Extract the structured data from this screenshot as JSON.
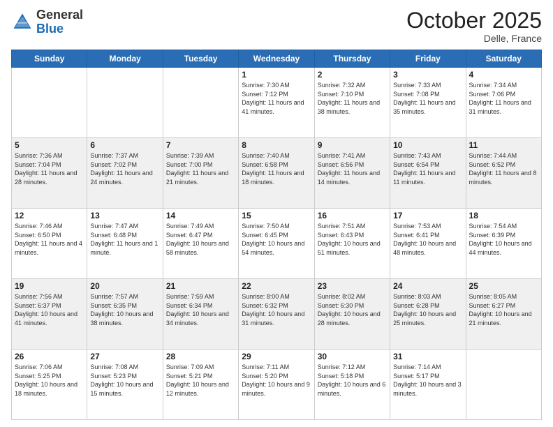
{
  "header": {
    "logo_general": "General",
    "logo_blue": "Blue",
    "month": "October 2025",
    "location": "Delle, France"
  },
  "weekdays": [
    "Sunday",
    "Monday",
    "Tuesday",
    "Wednesday",
    "Thursday",
    "Friday",
    "Saturday"
  ],
  "weeks": [
    [
      {
        "day": "",
        "sunrise": "",
        "sunset": "",
        "daylight": ""
      },
      {
        "day": "",
        "sunrise": "",
        "sunset": "",
        "daylight": ""
      },
      {
        "day": "",
        "sunrise": "",
        "sunset": "",
        "daylight": ""
      },
      {
        "day": "1",
        "sunrise": "Sunrise: 7:30 AM",
        "sunset": "Sunset: 7:12 PM",
        "daylight": "Daylight: 11 hours and 41 minutes."
      },
      {
        "day": "2",
        "sunrise": "Sunrise: 7:32 AM",
        "sunset": "Sunset: 7:10 PM",
        "daylight": "Daylight: 11 hours and 38 minutes."
      },
      {
        "day": "3",
        "sunrise": "Sunrise: 7:33 AM",
        "sunset": "Sunset: 7:08 PM",
        "daylight": "Daylight: 11 hours and 35 minutes."
      },
      {
        "day": "4",
        "sunrise": "Sunrise: 7:34 AM",
        "sunset": "Sunset: 7:06 PM",
        "daylight": "Daylight: 11 hours and 31 minutes."
      }
    ],
    [
      {
        "day": "5",
        "sunrise": "Sunrise: 7:36 AM",
        "sunset": "Sunset: 7:04 PM",
        "daylight": "Daylight: 11 hours and 28 minutes."
      },
      {
        "day": "6",
        "sunrise": "Sunrise: 7:37 AM",
        "sunset": "Sunset: 7:02 PM",
        "daylight": "Daylight: 11 hours and 24 minutes."
      },
      {
        "day": "7",
        "sunrise": "Sunrise: 7:39 AM",
        "sunset": "Sunset: 7:00 PM",
        "daylight": "Daylight: 11 hours and 21 minutes."
      },
      {
        "day": "8",
        "sunrise": "Sunrise: 7:40 AM",
        "sunset": "Sunset: 6:58 PM",
        "daylight": "Daylight: 11 hours and 18 minutes."
      },
      {
        "day": "9",
        "sunrise": "Sunrise: 7:41 AM",
        "sunset": "Sunset: 6:56 PM",
        "daylight": "Daylight: 11 hours and 14 minutes."
      },
      {
        "day": "10",
        "sunrise": "Sunrise: 7:43 AM",
        "sunset": "Sunset: 6:54 PM",
        "daylight": "Daylight: 11 hours and 11 minutes."
      },
      {
        "day": "11",
        "sunrise": "Sunrise: 7:44 AM",
        "sunset": "Sunset: 6:52 PM",
        "daylight": "Daylight: 11 hours and 8 minutes."
      }
    ],
    [
      {
        "day": "12",
        "sunrise": "Sunrise: 7:46 AM",
        "sunset": "Sunset: 6:50 PM",
        "daylight": "Daylight: 11 hours and 4 minutes."
      },
      {
        "day": "13",
        "sunrise": "Sunrise: 7:47 AM",
        "sunset": "Sunset: 6:48 PM",
        "daylight": "Daylight: 11 hours and 1 minute."
      },
      {
        "day": "14",
        "sunrise": "Sunrise: 7:49 AM",
        "sunset": "Sunset: 6:47 PM",
        "daylight": "Daylight: 10 hours and 58 minutes."
      },
      {
        "day": "15",
        "sunrise": "Sunrise: 7:50 AM",
        "sunset": "Sunset: 6:45 PM",
        "daylight": "Daylight: 10 hours and 54 minutes."
      },
      {
        "day": "16",
        "sunrise": "Sunrise: 7:51 AM",
        "sunset": "Sunset: 6:43 PM",
        "daylight": "Daylight: 10 hours and 51 minutes."
      },
      {
        "day": "17",
        "sunrise": "Sunrise: 7:53 AM",
        "sunset": "Sunset: 6:41 PM",
        "daylight": "Daylight: 10 hours and 48 minutes."
      },
      {
        "day": "18",
        "sunrise": "Sunrise: 7:54 AM",
        "sunset": "Sunset: 6:39 PM",
        "daylight": "Daylight: 10 hours and 44 minutes."
      }
    ],
    [
      {
        "day": "19",
        "sunrise": "Sunrise: 7:56 AM",
        "sunset": "Sunset: 6:37 PM",
        "daylight": "Daylight: 10 hours and 41 minutes."
      },
      {
        "day": "20",
        "sunrise": "Sunrise: 7:57 AM",
        "sunset": "Sunset: 6:35 PM",
        "daylight": "Daylight: 10 hours and 38 minutes."
      },
      {
        "day": "21",
        "sunrise": "Sunrise: 7:59 AM",
        "sunset": "Sunset: 6:34 PM",
        "daylight": "Daylight: 10 hours and 34 minutes."
      },
      {
        "day": "22",
        "sunrise": "Sunrise: 8:00 AM",
        "sunset": "Sunset: 6:32 PM",
        "daylight": "Daylight: 10 hours and 31 minutes."
      },
      {
        "day": "23",
        "sunrise": "Sunrise: 8:02 AM",
        "sunset": "Sunset: 6:30 PM",
        "daylight": "Daylight: 10 hours and 28 minutes."
      },
      {
        "day": "24",
        "sunrise": "Sunrise: 8:03 AM",
        "sunset": "Sunset: 6:28 PM",
        "daylight": "Daylight: 10 hours and 25 minutes."
      },
      {
        "day": "25",
        "sunrise": "Sunrise: 8:05 AM",
        "sunset": "Sunset: 6:27 PM",
        "daylight": "Daylight: 10 hours and 21 minutes."
      }
    ],
    [
      {
        "day": "26",
        "sunrise": "Sunrise: 7:06 AM",
        "sunset": "Sunset: 5:25 PM",
        "daylight": "Daylight: 10 hours and 18 minutes."
      },
      {
        "day": "27",
        "sunrise": "Sunrise: 7:08 AM",
        "sunset": "Sunset: 5:23 PM",
        "daylight": "Daylight: 10 hours and 15 minutes."
      },
      {
        "day": "28",
        "sunrise": "Sunrise: 7:09 AM",
        "sunset": "Sunset: 5:21 PM",
        "daylight": "Daylight: 10 hours and 12 minutes."
      },
      {
        "day": "29",
        "sunrise": "Sunrise: 7:11 AM",
        "sunset": "Sunset: 5:20 PM",
        "daylight": "Daylight: 10 hours and 9 minutes."
      },
      {
        "day": "30",
        "sunrise": "Sunrise: 7:12 AM",
        "sunset": "Sunset: 5:18 PM",
        "daylight": "Daylight: 10 hours and 6 minutes."
      },
      {
        "day": "31",
        "sunrise": "Sunrise: 7:14 AM",
        "sunset": "Sunset: 5:17 PM",
        "daylight": "Daylight: 10 hours and 3 minutes."
      },
      {
        "day": "",
        "sunrise": "",
        "sunset": "",
        "daylight": ""
      }
    ]
  ]
}
